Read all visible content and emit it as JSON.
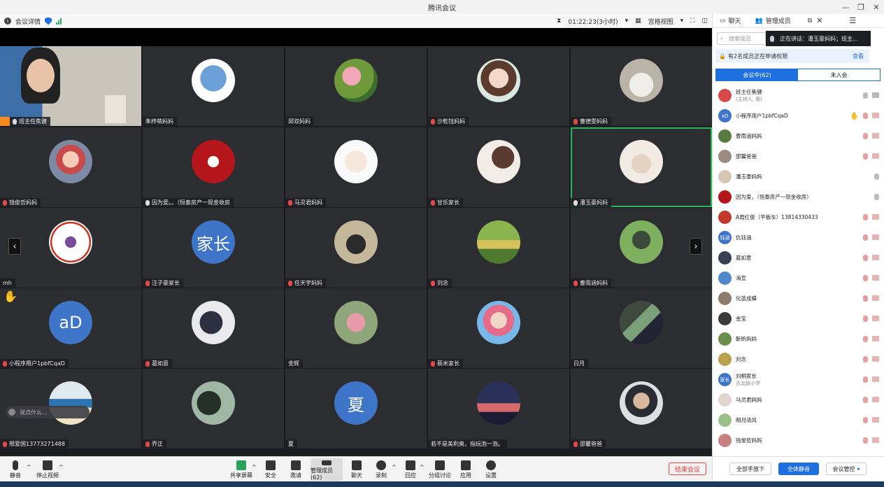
{
  "window": {
    "title": "腾讯会议"
  },
  "topbar": {
    "details_label": "会议详情",
    "timer": "01:22:23(3小时)",
    "view_mode": "宫格视图"
  },
  "grid": {
    "tiles": [
      {
        "name": "班主任焦健"
      },
      {
        "name": "朱梓萌妈妈"
      },
      {
        "name": "邱双妈妈"
      },
      {
        "name": "沙乾钰妈妈"
      },
      {
        "name": "曹德雯妈妈"
      },
      {
        "name": "钱俊哲妈妈"
      },
      {
        "name": "因为爱。。（恒泰房产一现金收房"
      },
      {
        "name": "马灵君妈妈"
      },
      {
        "name": "甘乐家长"
      },
      {
        "name": "潘玉豪妈妈"
      },
      {
        "name": "mh"
      },
      {
        "name": "汪子豪家长",
        "avatar_text": "家长"
      },
      {
        "name": "任天宇妈妈"
      },
      {
        "name": "刘念"
      },
      {
        "name": "曹雨涵妈妈"
      },
      {
        "name": "小程序用户1pbfCqaD",
        "avatar_text": "aD"
      },
      {
        "name": "葛如意"
      },
      {
        "name": "金辉"
      },
      {
        "name": "蔡米家长"
      },
      {
        "name": "日月"
      },
      {
        "name": "邢爱国13773271488"
      },
      {
        "name": "乔正"
      },
      {
        "name": "夏",
        "avatar_text": "夏"
      },
      {
        "name": "若不是美利奥，指玩泡一泡。"
      },
      {
        "name": "邵馨爸爸"
      }
    ],
    "chat_placeholder": "说点什么..."
  },
  "toolbar": {
    "mute": "静音",
    "stop_video": "停止视频",
    "share": "共享屏幕",
    "security": "安全",
    "invite": "邀请",
    "manage": "管理成员(62)",
    "chat": "聊天",
    "record": "录制",
    "react": "回应",
    "breakout": "分组讨论",
    "apps": "应用",
    "settings": "设置",
    "end": "结束会议"
  },
  "panel": {
    "tab_chat": "聊天",
    "tab_members": "管理成员",
    "search_placeholder": "搜索成员",
    "speaking": "正在讲话：潘玉豪妈妈；班主...",
    "notice": "有2名成员正在申请权限",
    "notice_action": "查看",
    "seg_in": "会议中(62)",
    "seg_out": "未入会",
    "members": [
      {
        "name": "班主任焦健",
        "sub": "(主持人, 我)"
      },
      {
        "name": "小程序用户1pbfCqaD",
        "avatar_text": "aD"
      },
      {
        "name": "曹雨涵妈妈"
      },
      {
        "name": "邵馨爸爸"
      },
      {
        "name": "潘玉豪妈妈"
      },
      {
        "name": "因为爱。（恒泰房产一现金收房）"
      },
      {
        "name": "A周红俊（平板车）13814330433"
      },
      {
        "name": "仇钰涵",
        "avatar_text": "钰涵"
      },
      {
        "name": "葛如意"
      },
      {
        "name": "海宣"
      },
      {
        "name": "化蓝成蝶"
      },
      {
        "name": "金宝"
      },
      {
        "name": "靳昕妈妈"
      },
      {
        "name": "刘念"
      },
      {
        "name": "刘桐家长",
        "sub": "古北路小学",
        "avatar_text": "家长"
      },
      {
        "name": "马灵君妈妈"
      },
      {
        "name": "明月清风"
      },
      {
        "name": "钱俊哲妈妈"
      }
    ],
    "btn_all_raise": "全部手放下",
    "btn_mute_all": "全体静音",
    "btn_control": "会议管控"
  }
}
